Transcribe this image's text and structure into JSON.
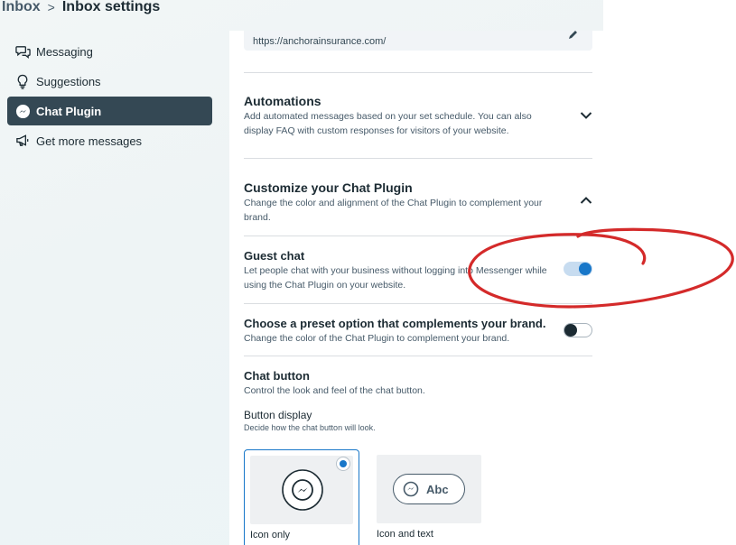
{
  "header": {
    "root": "Inbox",
    "separator": ">",
    "title": "Inbox settings"
  },
  "sidebar": {
    "items": [
      {
        "label": "Messaging",
        "icon": "speech-bubbles-icon",
        "active": false
      },
      {
        "label": "Suggestions",
        "icon": "lightbulb-icon",
        "active": false
      },
      {
        "label": "Chat Plugin",
        "icon": "messenger-icon",
        "active": true
      },
      {
        "label": "Get more messages",
        "icon": "megaphone-icon",
        "active": false
      }
    ]
  },
  "panel": {
    "url_value": "https://anchorainsurance.com/",
    "automations": {
      "title": "Automations",
      "desc": "Add automated messages based on your set schedule. You can also display FAQ with custom responses for visitors of your website.",
      "expanded": false
    },
    "customize": {
      "title": "Customize your Chat Plugin",
      "desc": "Change the color and alignment of the Chat Plugin to complement your brand.",
      "expanded": true
    },
    "guest_chat": {
      "title": "Guest chat",
      "desc": "Let people chat with your business without logging into Messenger while using the Chat Plugin on your website.",
      "enabled": true
    },
    "preset": {
      "title": "Choose a preset option that complements your brand.",
      "desc": "Change the color of the Chat Plugin to complement your brand.",
      "enabled": false
    },
    "chat_button": {
      "title": "Chat button",
      "desc": "Control the look and feel of the chat button."
    },
    "button_display": {
      "title": "Button display",
      "desc": "Decide how the chat button will look.",
      "options": [
        {
          "label": "Icon only",
          "selected": true
        },
        {
          "label": "Icon and text",
          "selected": false,
          "preview_text": "Abc"
        }
      ]
    }
  },
  "colors": {
    "accent": "#1877c9",
    "sidebar_active": "#344854",
    "annotation": "#d42a2a"
  }
}
